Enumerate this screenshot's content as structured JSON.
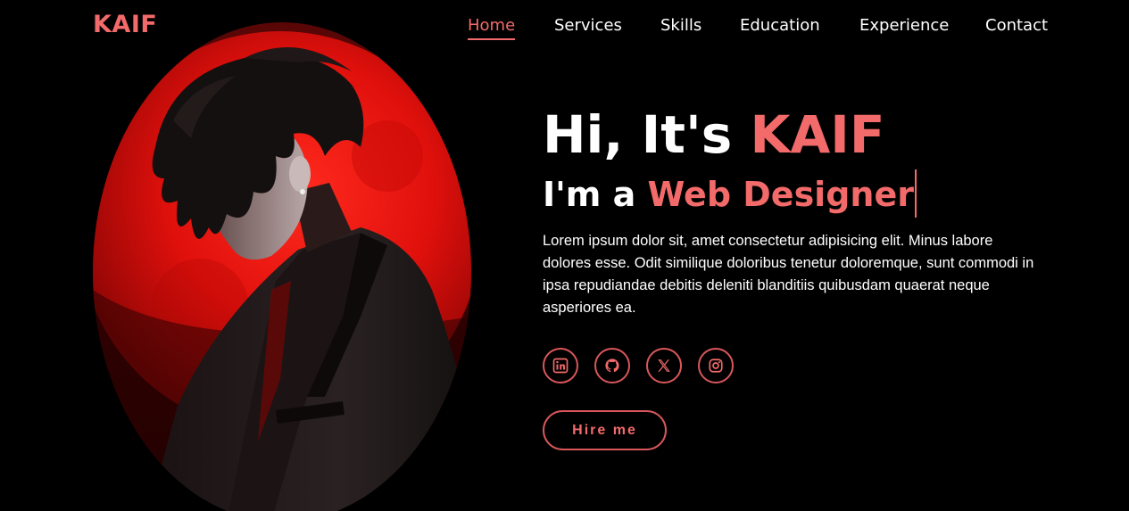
{
  "brand": {
    "logo": "KAIF",
    "accent_color": "#f26a6a"
  },
  "nav": {
    "items": [
      {
        "label": "Home",
        "active": true
      },
      {
        "label": "Services",
        "active": false
      },
      {
        "label": "Skills",
        "active": false
      },
      {
        "label": "Education",
        "active": false
      },
      {
        "label": "Experience",
        "active": false
      },
      {
        "label": "Contact",
        "active": false
      }
    ]
  },
  "hero": {
    "greeting_prefix": "Hi, It's",
    "name": "KAIF",
    "role_prefix": "I'm a",
    "role": "Web Designer",
    "bio": "Lorem ipsum dolor sit, amet consectetur adipisicing elit. Minus labore dolores esse. Odit similique doloribus tenetur doloremque, sunt commodi in ipsa repudiandae debitis deleniti blanditiis quibusdam quaerat neque asperiores ea.",
    "hire_label": "Hire me"
  },
  "socials": [
    {
      "icon": "linkedin-icon"
    },
    {
      "icon": "github-icon"
    },
    {
      "icon": "x-icon"
    },
    {
      "icon": "instagram-icon"
    }
  ],
  "portrait": {
    "icon": "portrait-image",
    "colors": {
      "moon": "#e0100c",
      "background": "#0a0000"
    }
  }
}
